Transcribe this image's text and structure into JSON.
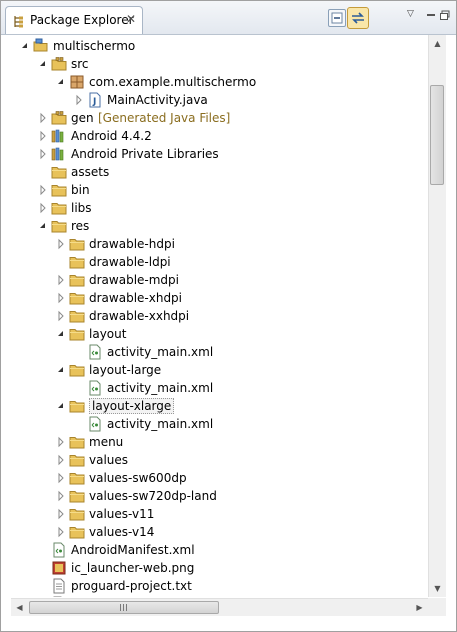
{
  "view": {
    "title": "Package Explorer",
    "toolbar": {
      "collapse_all": "collapse-all-icon",
      "link_with_editor": "link-with-editor-icon",
      "view_menu": "view-menu-icon",
      "minimize": "minimize-icon",
      "maximize": "maximize-icon"
    }
  },
  "tree": [
    {
      "label": "multischermo",
      "icon": "project-icon",
      "expand": "expanded"
    },
    {
      "label": "src",
      "icon": "source-folder-icon",
      "expand": "expanded"
    },
    {
      "label": "com.example.multischermo",
      "icon": "package-icon",
      "expand": "expanded"
    },
    {
      "label": "MainActivity.java",
      "icon": "java-file-icon",
      "expand": "collapsed"
    },
    {
      "label": "gen",
      "decor": " [Generated Java Files]",
      "icon": "source-folder-icon",
      "expand": "collapsed"
    },
    {
      "label": "Android 4.4.2",
      "icon": "library-icon",
      "expand": "collapsed"
    },
    {
      "label": "Android Private Libraries",
      "icon": "library-icon",
      "expand": "collapsed"
    },
    {
      "label": "assets",
      "icon": "folder-icon",
      "expand": "none"
    },
    {
      "label": "bin",
      "icon": "folder-icon",
      "expand": "collapsed"
    },
    {
      "label": "libs",
      "icon": "folder-icon",
      "expand": "collapsed"
    },
    {
      "label": "res",
      "icon": "folder-icon",
      "expand": "expanded"
    },
    {
      "label": "drawable-hdpi",
      "icon": "folder-icon",
      "expand": "collapsed"
    },
    {
      "label": "drawable-ldpi",
      "icon": "folder-icon",
      "expand": "none"
    },
    {
      "label": "drawable-mdpi",
      "icon": "folder-icon",
      "expand": "collapsed"
    },
    {
      "label": "drawable-xhdpi",
      "icon": "folder-icon",
      "expand": "collapsed"
    },
    {
      "label": "drawable-xxhdpi",
      "icon": "folder-icon",
      "expand": "collapsed"
    },
    {
      "label": "layout",
      "icon": "folder-icon",
      "expand": "expanded"
    },
    {
      "label": "activity_main.xml",
      "icon": "xml-file-icon",
      "expand": "none"
    },
    {
      "label": "layout-large",
      "icon": "folder-icon",
      "expand": "expanded"
    },
    {
      "label": "activity_main.xml",
      "icon": "xml-file-icon",
      "expand": "none"
    },
    {
      "label": "layout-xlarge",
      "icon": "folder-icon",
      "expand": "expanded",
      "selected": true
    },
    {
      "label": "activity_main.xml",
      "icon": "xml-file-icon",
      "expand": "none"
    },
    {
      "label": "menu",
      "icon": "folder-icon",
      "expand": "collapsed"
    },
    {
      "label": "values",
      "icon": "folder-icon",
      "expand": "collapsed"
    },
    {
      "label": "values-sw600dp",
      "icon": "folder-icon",
      "expand": "collapsed"
    },
    {
      "label": "values-sw720dp-land",
      "icon": "folder-icon",
      "expand": "collapsed"
    },
    {
      "label": "values-v11",
      "icon": "folder-icon",
      "expand": "collapsed"
    },
    {
      "label": "values-v14",
      "icon": "folder-icon",
      "expand": "collapsed"
    },
    {
      "label": "AndroidManifest.xml",
      "icon": "xml-file-icon",
      "expand": "none"
    },
    {
      "label": "ic_launcher-web.png",
      "icon": "image-file-icon",
      "expand": "none"
    },
    {
      "label": "proguard-project.txt",
      "icon": "text-file-icon",
      "expand": "none"
    },
    {
      "label": "project.properties",
      "icon": "text-file-icon",
      "expand": "none"
    }
  ],
  "colors": {
    "folder": "#e8c25a",
    "folder_border": "#a8842c",
    "selection_border": "#9a9a9a",
    "decoration": "#8a6d1f"
  }
}
